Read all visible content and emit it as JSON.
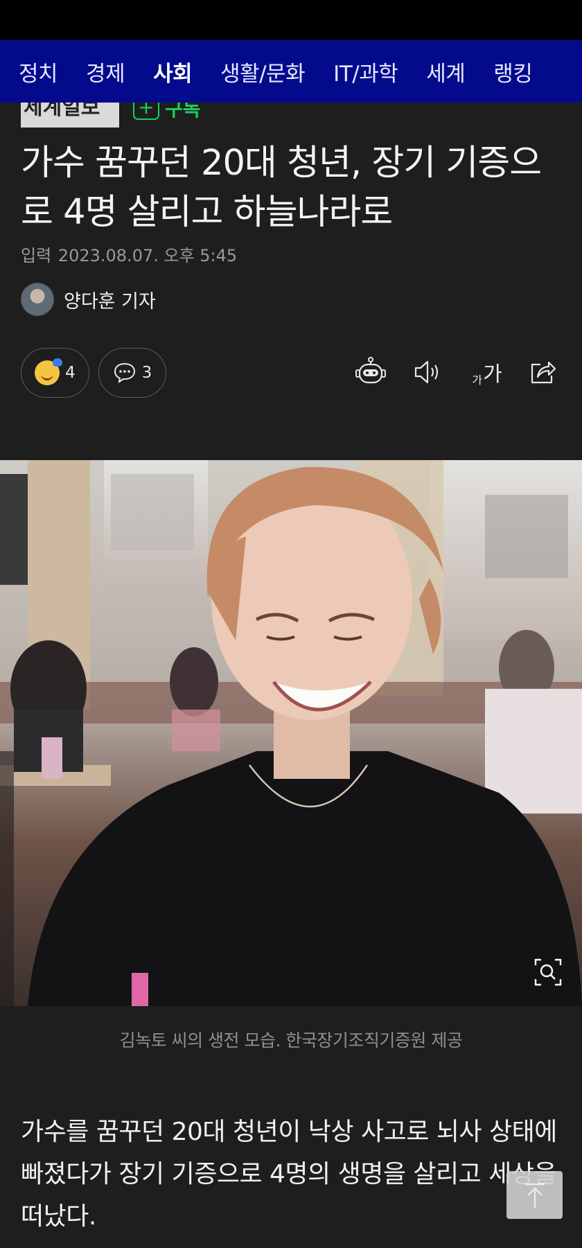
{
  "nav": {
    "items": [
      "정치",
      "경제",
      "사회",
      "생활/문화",
      "IT/과학",
      "세계",
      "랭킹"
    ],
    "active_index": 2
  },
  "press": {
    "logo_text": "세계일보",
    "subscribe_label": "구독"
  },
  "article": {
    "headline": "가수 꿈꾸던 20대 청년, 장기 기증으로 4명 살리고 하늘나라로",
    "date_label": "입력",
    "date_value": "2023.08.07. 오후 5:45",
    "reporter": "양다훈 기자",
    "reaction_count": "4",
    "comment_count": "3",
    "photo_caption": "김녹토 씨의 생전 모습. 한국장기조직기증원 제공",
    "body_first_paragraph": "가수를 꿈꾸던 20대 청년이 낙상 사고로 뇌사 상태에 빠졌다가 장기 기증으로 4명의 생명을 살리고 세상을 떠났다."
  },
  "toolbar": {
    "font_size_small": "가",
    "font_size_large": "가"
  },
  "colors": {
    "nav_bg": "#030b8c",
    "page_bg": "#1e1e1f",
    "subscribe_green": "#18d15a"
  },
  "icons": [
    "robot-icon",
    "speaker-icon",
    "font-size-icon",
    "share-icon",
    "zoom-icon",
    "scroll-top-icon",
    "comment-icon",
    "reaction-emoji-icon"
  ]
}
